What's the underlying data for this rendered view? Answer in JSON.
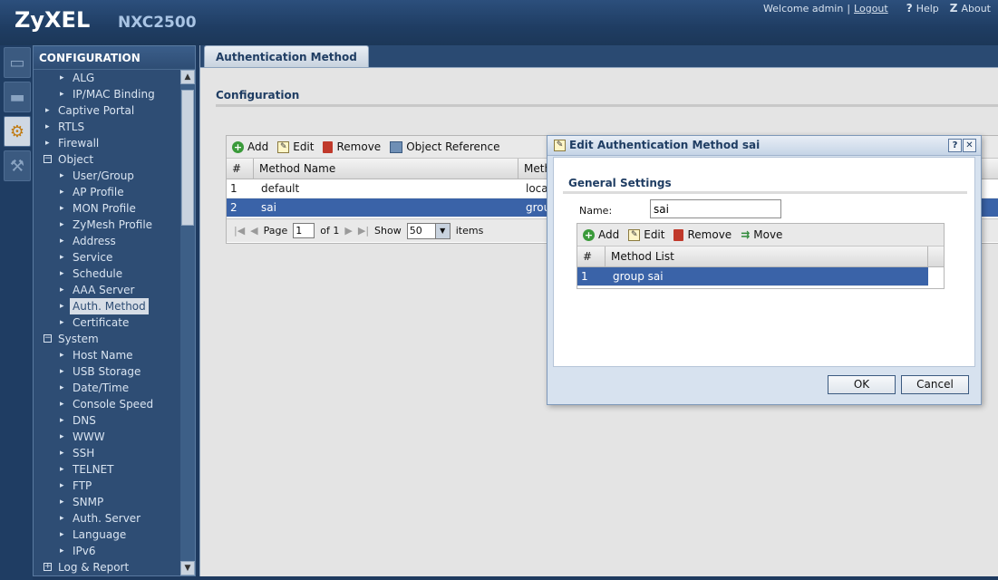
{
  "header": {
    "brand": "ZyXEL",
    "model": "NXC2500",
    "welcome": "Welcome admin",
    "separator": "|",
    "logout": "Logout",
    "help": "Help",
    "about": "About"
  },
  "sidebar": {
    "title": "CONFIGURATION",
    "items": [
      {
        "label": "ALG",
        "level": 2
      },
      {
        "label": "IP/MAC Binding",
        "level": 2
      },
      {
        "label": "Captive Portal",
        "level": 1,
        "type": "bullet"
      },
      {
        "label": "RTLS",
        "level": 1,
        "type": "bullet"
      },
      {
        "label": "Firewall",
        "level": 1,
        "type": "bullet"
      },
      {
        "label": "Object",
        "level": 1,
        "type": "collapse"
      },
      {
        "label": "User/Group",
        "level": 2
      },
      {
        "label": "AP Profile",
        "level": 2
      },
      {
        "label": "MON Profile",
        "level": 2
      },
      {
        "label": "ZyMesh Profile",
        "level": 2
      },
      {
        "label": "Address",
        "level": 2
      },
      {
        "label": "Service",
        "level": 2
      },
      {
        "label": "Schedule",
        "level": 2
      },
      {
        "label": "AAA Server",
        "level": 2
      },
      {
        "label": "Auth. Method",
        "level": 2,
        "selected": true
      },
      {
        "label": "Certificate",
        "level": 2
      },
      {
        "label": "System",
        "level": 1,
        "type": "collapse"
      },
      {
        "label": "Host Name",
        "level": 2
      },
      {
        "label": "USB Storage",
        "level": 2
      },
      {
        "label": "Date/Time",
        "level": 2
      },
      {
        "label": "Console Speed",
        "level": 2
      },
      {
        "label": "DNS",
        "level": 2
      },
      {
        "label": "WWW",
        "level": 2
      },
      {
        "label": "SSH",
        "level": 2
      },
      {
        "label": "TELNET",
        "level": 2
      },
      {
        "label": "FTP",
        "level": 2
      },
      {
        "label": "SNMP",
        "level": 2
      },
      {
        "label": "Auth. Server",
        "level": 2
      },
      {
        "label": "Language",
        "level": 2
      },
      {
        "label": "IPv6",
        "level": 2
      },
      {
        "label": "Log & Report",
        "level": 1,
        "type": "expand"
      }
    ]
  },
  "main": {
    "tab": "Authentication Method",
    "section_title": "Configuration",
    "toolbar": {
      "add": "Add",
      "edit": "Edit",
      "remove": "Remove",
      "object_reference": "Object Reference"
    },
    "columns": [
      "#",
      "Method Name",
      "Meth"
    ],
    "rows": [
      {
        "num": "1",
        "name": "default",
        "method": "loca"
      },
      {
        "num": "2",
        "name": "sai",
        "method": "grou"
      }
    ],
    "pager": {
      "page_label": "Page",
      "page_value": "1",
      "of_label": "of 1",
      "show_label": "Show",
      "show_value": "50",
      "items_label": "items"
    }
  },
  "dialog": {
    "title": "Edit Authentication Method sai",
    "section_title": "General Settings",
    "name_label": "Name:",
    "name_value": "sai",
    "toolbar": {
      "add": "Add",
      "edit": "Edit",
      "remove": "Remove",
      "move": "Move"
    },
    "columns": [
      "#",
      "Method List"
    ],
    "rows": [
      {
        "num": "1",
        "method": "group sai"
      }
    ],
    "ok": "OK",
    "cancel": "Cancel",
    "help_glyph": "?",
    "close_glyph": "✕"
  },
  "colors": {
    "header_bg": "#1f3d63",
    "sidebar_bg": "#2e4d74",
    "selection_bg": "#3a63a8",
    "dialog_title": "#1f3d63"
  }
}
